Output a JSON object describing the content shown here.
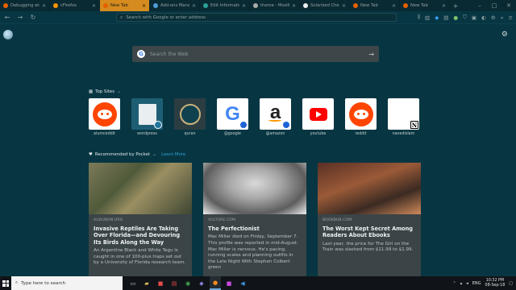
{
  "tabs": [
    {
      "label": "Debugging with Fir",
      "fav_color": "#e66000",
      "active": false
    },
    {
      "label": "cFirefox",
      "fav_color": "#ff9400",
      "active": false
    },
    {
      "label": "New Tab",
      "fav_color": "#e66000",
      "active": true
    },
    {
      "label": "Add-ons Manag",
      "fav_color": "#4c9ed9",
      "active": false
    },
    {
      "label": "Edit Information",
      "fav_color": "#2aa198",
      "active": false
    },
    {
      "label": "theme - Mozilla",
      "fav_color": "#aaaaaa",
      "active": false
    },
    {
      "label": "Solarized Cheat",
      "fav_color": "#eeeeee",
      "active": false
    },
    {
      "label": "New Tab",
      "fav_color": "#e66000",
      "active": false
    },
    {
      "label": "New Tab",
      "fav_color": "#e66000",
      "active": false
    }
  ],
  "toolbar": {
    "url_placeholder": "Search with Google or enter address"
  },
  "search": {
    "placeholder": "Search the Web"
  },
  "top_sites": {
    "heading": "Top Sites",
    "sites": [
      {
        "label": "alumceddit",
        "kind": "reddit"
      },
      {
        "label": "wordpress",
        "kind": "wordpress"
      },
      {
        "label": "quran",
        "kind": "quran"
      },
      {
        "label": "@google",
        "kind": "google"
      },
      {
        "label": "@amazon",
        "kind": "amazon"
      },
      {
        "label": "youtube",
        "kind": "youtube"
      },
      {
        "label": "reddit",
        "kind": "reddit"
      },
      {
        "label": "navedislam",
        "kind": "notion"
      }
    ]
  },
  "pocket": {
    "heading": "Recommended by Pocket",
    "learn_more": "Learn More",
    "cards": [
      {
        "source": "AUDUBON.ORG",
        "title": "Invasive Reptiles Are Taking Over Florida—and Devouring Its Birds Along the Way",
        "excerpt": "An Argentine Black and White Tegu is caught in one of 100-plus traps set out by a University of Florida research team."
      },
      {
        "source": "VULTURE.COM",
        "title": "The Perfectionist",
        "excerpt": "Mac Miller died on Friday, September 7. This profile was reported in mid-August. Mac Miller is nervous. He's pacing, running scales and planning outfits in the Late Night With Stephen Colbert green"
      },
      {
        "source": "BOOKBUB.COM",
        "title": "The Worst Kept Secret Among Readers About Ebooks",
        "excerpt": "Last year, the price for The Girl on the Train was slashed from $11.99 to $1.99."
      }
    ]
  },
  "taskbar": {
    "search_placeholder": "Type here to search",
    "lang": "ENG",
    "time": "10:32 PM",
    "date": "08-Sep-18"
  }
}
